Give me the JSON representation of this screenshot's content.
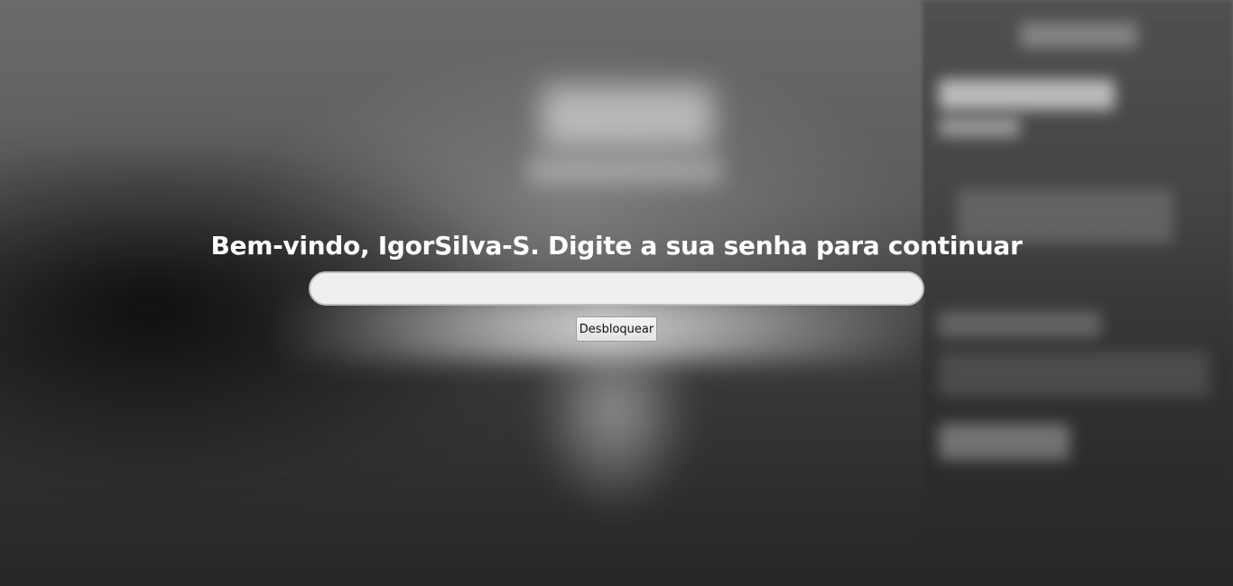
{
  "lock_screen": {
    "welcome_message": "Bem-vindo, IgorSilva-S. Digite a sua senha para continuar",
    "password_value": "",
    "unlock_button_label": "Desbloquear"
  }
}
